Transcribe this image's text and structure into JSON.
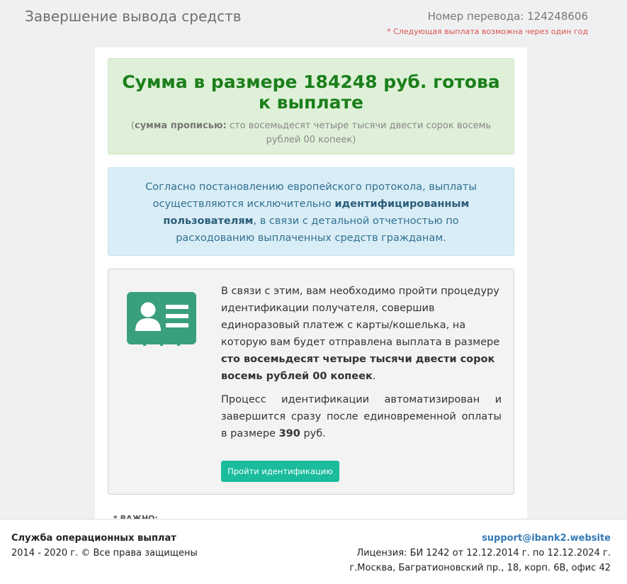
{
  "header": {
    "title": "Завершение вывода средств",
    "transfer_number": "Номер перевода: 124248606",
    "next_payout_note": "* Следующая выплата возможна через один год"
  },
  "success": {
    "title": "Сумма в размере 184248 руб. готова к выплате",
    "words_open": "(",
    "words_label": "сумма прописью:",
    "words_text": " сто восемьдесят четыре тысячи двести сорок восемь рублей 00 копеек)"
  },
  "info": {
    "text_before": "Согласно постановлению европейского протокола, выплаты осуществляются исключительно ",
    "bold": "идентифицированным пользователям",
    "text_after": ", в связи с детальной отчетностью по расходованию выплаченных средств гражданам."
  },
  "identification": {
    "icon": "id-card-icon",
    "icon_color": "#3a9f7e",
    "p1_text": "В связи с этим, вам необходимо пройти процедуру идентификации получателя, совершив единоразовый платеж с карты/кошелька, на которую вам будет отправлена выплата в размере ",
    "p1_bold": "сто восемьдесят четыре тысячи двести сорок восемь рублей 00 копеек",
    "p1_end": ".",
    "p2_text": "Процесс идентификации автоматизирован и завершится сразу после единовременной оплаты в размере ",
    "p2_bold": "390",
    "p2_end": " руб.",
    "button_label": "Пройти идентификацию",
    "button_color": "#1abc9c"
  },
  "important_peek": "* ВАЖНО: ... ... ...",
  "footer": {
    "service_name": "Служба операционных выплат",
    "copyright": "2014 - 2020 г. © Все права защищены",
    "email": "support@ibank2.website",
    "license": "Лицензия: БИ 1242 от 12.12.2014 г. по 12.12.2024 г.",
    "address": "г.Москва, Багратионовский пр., 18, корп. 6В, офис 42"
  }
}
